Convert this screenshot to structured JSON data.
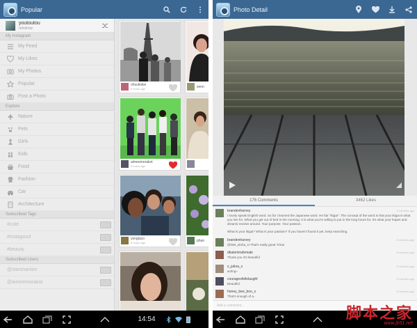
{
  "left": {
    "title": "Popular",
    "user": {
      "name": "youtoutou",
      "sub": "refold.biz"
    },
    "sections": {
      "instagram": "My Instagram",
      "explore": "Explore",
      "tags": "Subscribed Tags",
      "users": "Subscribed Users"
    },
    "instagram_items": [
      {
        "label": "My Feed",
        "icon": "feed-icon"
      },
      {
        "label": "My Likes",
        "icon": "likes-icon"
      },
      {
        "label": "My Photos",
        "icon": "photos-icon"
      },
      {
        "label": "Popular",
        "icon": "star-icon"
      },
      {
        "label": "Post a Photo",
        "icon": "camera-icon"
      }
    ],
    "explore_items": [
      {
        "label": "Nature",
        "icon": "tree-icon"
      },
      {
        "label": "Pets",
        "icon": "paw-icon"
      },
      {
        "label": "Girls",
        "icon": "girl-icon"
      },
      {
        "label": "Kids",
        "icon": "kids-icon"
      },
      {
        "label": "Food",
        "icon": "food-icon"
      },
      {
        "label": "Fashion",
        "icon": "fashion-icon"
      },
      {
        "label": "Car",
        "icon": "car-icon"
      },
      {
        "label": "Architecture",
        "icon": "building-icon"
      }
    ],
    "tags": [
      "#cute",
      "#instagood",
      "#beauty"
    ],
    "users": [
      "@starsnanion",
      "@aimeemorakot"
    ],
    "feed": [
      {
        "name": "ohsuliokie",
        "time": "5 hours ago",
        "liked": false
      },
      {
        "name": "senn",
        "time": "",
        "liked": false
      },
      {
        "name": "aimeemorakot",
        "time": "5 hours ago",
        "liked": true
      },
      {
        "name": "",
        "time": "",
        "liked": false
      },
      {
        "name": "yonglaco",
        "time": "6 hours ago",
        "liked": false
      },
      {
        "name": "phan",
        "time": "",
        "liked": false
      }
    ],
    "clock": "14:54"
  },
  "right": {
    "title": "Photo Detail",
    "tab_comments": "176 Comments",
    "tab_likes": "3462 Likes",
    "comments": [
      {
        "user": "brandenharvey",
        "time": "3 minutes ago",
        "text": "I lovely speak English word. So far I learned the Japanese word. He fair \"ikigai\". The concept of the word is that your ikigai is what you live for. What you get out of bed in the morning. It is what you're willing to put in the long hours for. It's what your hopes and dreams revolve around. Your purpose. Your passion."
      },
      {
        "user": "",
        "time": "",
        "text": "What is your ikigai? What is your passion? If you haven't found it yet, keep searching."
      },
      {
        "user": "brandenharvey",
        "time": "5 minutes ago",
        "text": "@NW_aloha_H That's really great Trina!"
      },
      {
        "user": "dkatemirafemale",
        "time": "5 minutes ago",
        "text": "Thank you it's beautiful"
      },
      {
        "user": "x_julioa_x",
        "time": "5 minutes ago",
        "text": "acting~"
      },
      {
        "user": "courageofellelaught",
        "time": "5 minutes ago",
        "text": "Beautiful"
      },
      {
        "user": "honey_bee_boo_x",
        "time": "5 minutes ago",
        "text": "That's enough of a.."
      }
    ],
    "input_placeholder": "Add a comment..."
  },
  "watermark": {
    "big": "脚本之家",
    "small": "www.jb51.net"
  }
}
